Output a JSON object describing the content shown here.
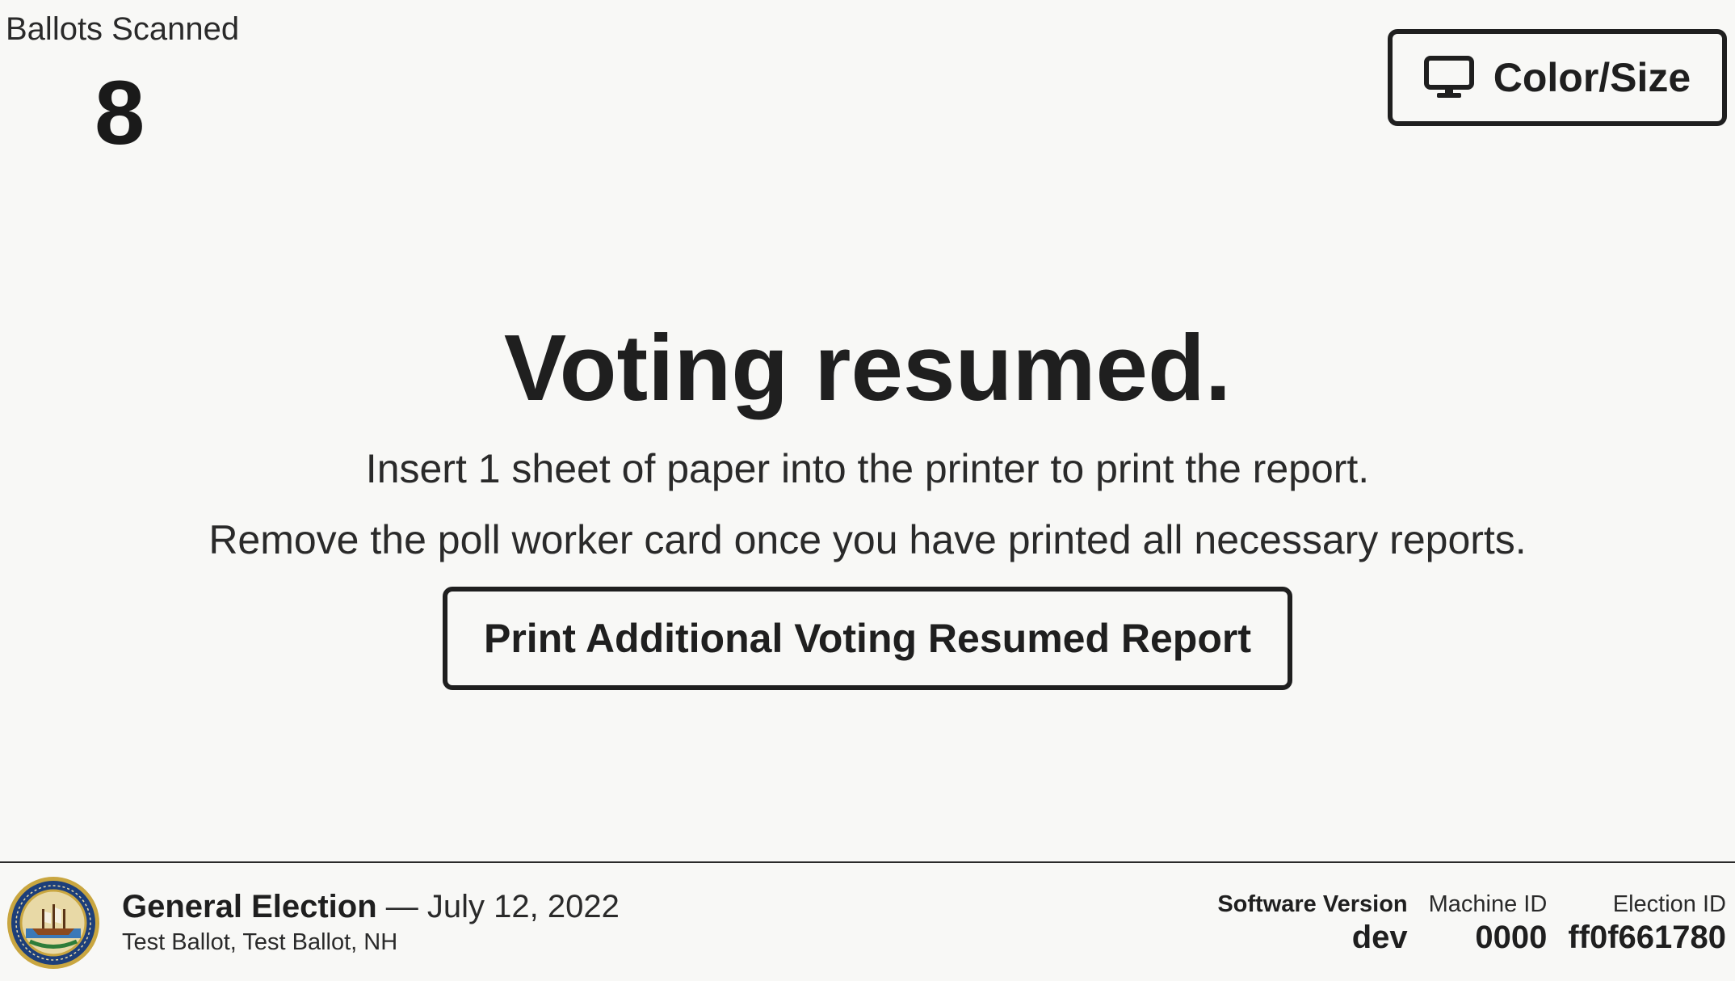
{
  "ballots": {
    "label": "Ballots Scanned",
    "count": "8"
  },
  "display_settings": {
    "label": "Color/Size",
    "icon": "monitor-icon"
  },
  "main": {
    "title": "Voting resumed.",
    "instruction_1": "Insert 1 sheet of paper into the printer to print the report.",
    "instruction_2": "Remove the poll worker card once you have printed all necessary reports.",
    "print_button_label": "Print Additional Voting Resumed Report"
  },
  "footer": {
    "seal_icon": "state-seal-icon",
    "election_title": "General Election",
    "separator": "—",
    "election_date": "July 12, 2022",
    "election_sub": "Test Ballot, Test Ballot, NH",
    "software_version_label": "Software Version",
    "software_version_value": "dev",
    "machine_id_label": "Machine ID",
    "machine_id_value": "0000",
    "election_id_label": "Election ID",
    "election_id_value": "ff0f661780"
  },
  "colors": {
    "background": "#f8f8f6",
    "text": "#1f1f1f",
    "border": "#1f1f1f"
  }
}
